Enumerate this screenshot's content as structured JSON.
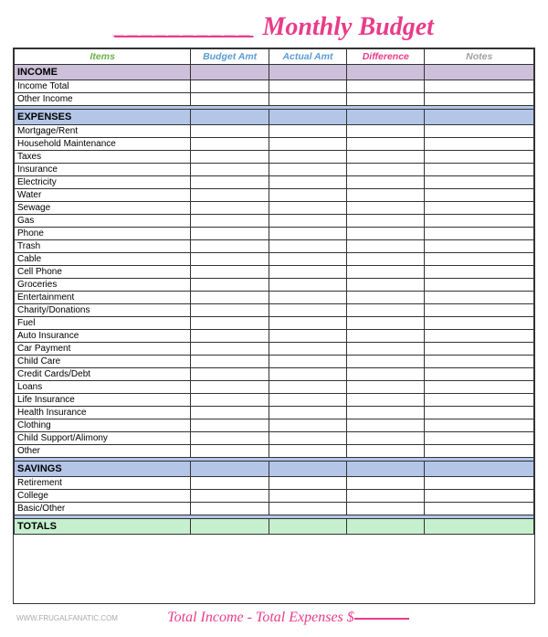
{
  "header": {
    "title": "Monthly Budget"
  },
  "columns": {
    "items": "Items",
    "budget": "Budget Amt",
    "actual": "Actual Amt",
    "difference": "Difference",
    "notes": "Notes"
  },
  "sections": {
    "income": {
      "label": "INCOME",
      "rows": [
        "Income Total",
        "Other Income"
      ]
    },
    "expenses": {
      "label": "EXPENSES",
      "rows": [
        "Mortgage/Rent",
        "Household Maintenance",
        "Taxes",
        "Insurance",
        "Electricity",
        "Water",
        "Sewage",
        "Gas",
        "Phone",
        "Trash",
        "Cable",
        "Cell Phone",
        "Groceries",
        "Entertainment",
        "Charity/Donations",
        "Fuel",
        "Auto Insurance",
        "Car Payment",
        "Child Care",
        "Credit Cards/Debt",
        "Loans",
        "Life Insurance",
        "Health Insurance",
        "Clothing",
        "Child Support/Alimony",
        "Other"
      ]
    },
    "savings": {
      "label": "SAVINGS",
      "rows": [
        "Retirement",
        "College",
        "Basic/Other"
      ]
    },
    "totals": {
      "label": "TOTALS"
    }
  },
  "footer": {
    "formula": "Total Income - Total Expenses $",
    "url": "WWW.FRUGALFANATIC.COM"
  }
}
